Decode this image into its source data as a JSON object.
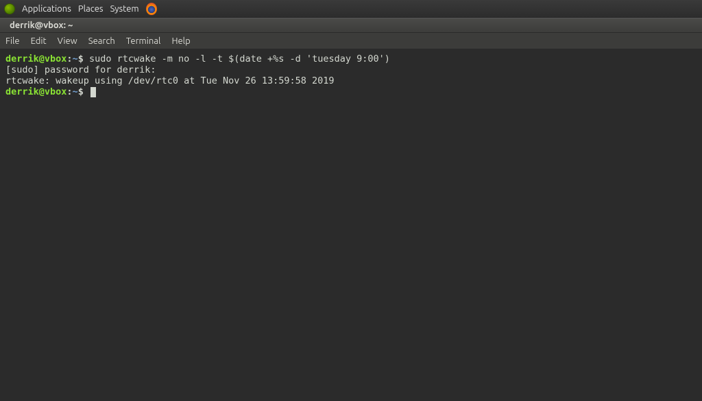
{
  "panel": {
    "applications": "Applications",
    "places": "Places",
    "system": "System"
  },
  "window": {
    "title": "derrik@vbox: ~"
  },
  "menubar": {
    "file": "File",
    "edit": "Edit",
    "view": "View",
    "search": "Search",
    "terminal": "Terminal",
    "help": "Help"
  },
  "terminal": {
    "prompt_user": "derrik@vbox",
    "prompt_sep": ":",
    "prompt_path": "~",
    "prompt_dollar": "$",
    "line1_cmd": " sudo rtcwake -m no -l -t $(date +%s -d 'tuesday 9:00')",
    "line2": "[sudo] password for derrik:",
    "line3": "rtcwake: wakeup using /dev/rtc0 at Tue Nov 26 13:59:58 2019",
    "line4_after": " "
  }
}
